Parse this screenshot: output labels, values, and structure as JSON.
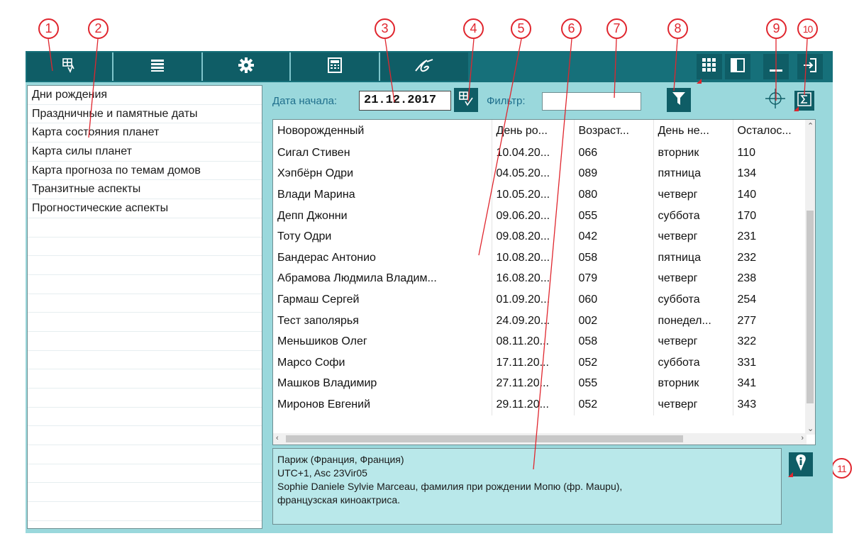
{
  "callouts": [
    "1",
    "2",
    "3",
    "4",
    "5",
    "6",
    "7",
    "8",
    "9",
    "10",
    "11"
  ],
  "toolbar": {
    "tabs": [
      {
        "name": "table-list-icon"
      },
      {
        "name": "list-icon"
      },
      {
        "name": "gear-icon"
      },
      {
        "name": "calculator-icon"
      },
      {
        "name": "signature-icon"
      }
    ],
    "right": [
      {
        "name": "grid-view-icon"
      },
      {
        "name": "panel-toggle-icon"
      },
      {
        "name": "minimize-icon"
      },
      {
        "name": "exit-icon"
      }
    ],
    "accent": "#0f5d66",
    "marker_color": "#e0262e"
  },
  "left_list": {
    "items": [
      "Дни рождения",
      "Праздничные и памятные даты",
      "Карта состояния планет",
      "Карта силы планет",
      "Карта прогноза по темам домов",
      "Транзитные аспекты",
      "Прогностические аспекты"
    ]
  },
  "controls": {
    "start_date_label": "Дата начала:",
    "start_date_value": "21.12.2017",
    "filter_label": "Фильтр:",
    "filter_value": ""
  },
  "table": {
    "headers": [
      "Новорожденный",
      "День ро...",
      "Возраст...",
      "День не...",
      "Осталос..."
    ],
    "rows": [
      [
        "Сигал Стивен",
        "10.04.20...",
        "066",
        "вторник",
        "110"
      ],
      [
        "Хэпбёрн Одри",
        "04.05.20...",
        "089",
        "пятница",
        "134"
      ],
      [
        "Влади Марина",
        "10.05.20...",
        "080",
        "четверг",
        "140"
      ],
      [
        "Депп Джонни",
        "09.06.20...",
        "055",
        "суббота",
        "170"
      ],
      [
        "Тоту Одри",
        "09.08.20...",
        "042",
        "четверг",
        "231"
      ],
      [
        "Бандерас Антонио",
        "10.08.20...",
        "058",
        "пятница",
        "232"
      ],
      [
        "Абрамова Людмила Владим...",
        "16.08.20...",
        "079",
        "четверг",
        "238"
      ],
      [
        "Гармаш Сергей",
        "01.09.20...",
        "060",
        "суббота",
        "254"
      ],
      [
        "Тест заполярья",
        "24.09.20...",
        "002",
        "понедел...",
        "277"
      ],
      [
        "Меньшиков Олег",
        "08.11.20...",
        "058",
        "четверг",
        "322"
      ],
      [
        "Марсо Софи",
        "17.11.20...",
        "052",
        "суббота",
        "331"
      ],
      [
        "Машков Владимир",
        "27.11.20...",
        "055",
        "вторник",
        "341"
      ],
      [
        "Миронов Евгений",
        "29.11.20...",
        "052",
        "четверг",
        "343"
      ]
    ]
  },
  "info": {
    "line1": "Париж (Франция, Франция)",
    "line2": "UTC+1, Asc 23Vir05",
    "line3": "Sophie Daniele Sylvie Marceau, фамилия при рождении Мопю (фр. Maupu),",
    "line4": "французская киноактриса."
  }
}
